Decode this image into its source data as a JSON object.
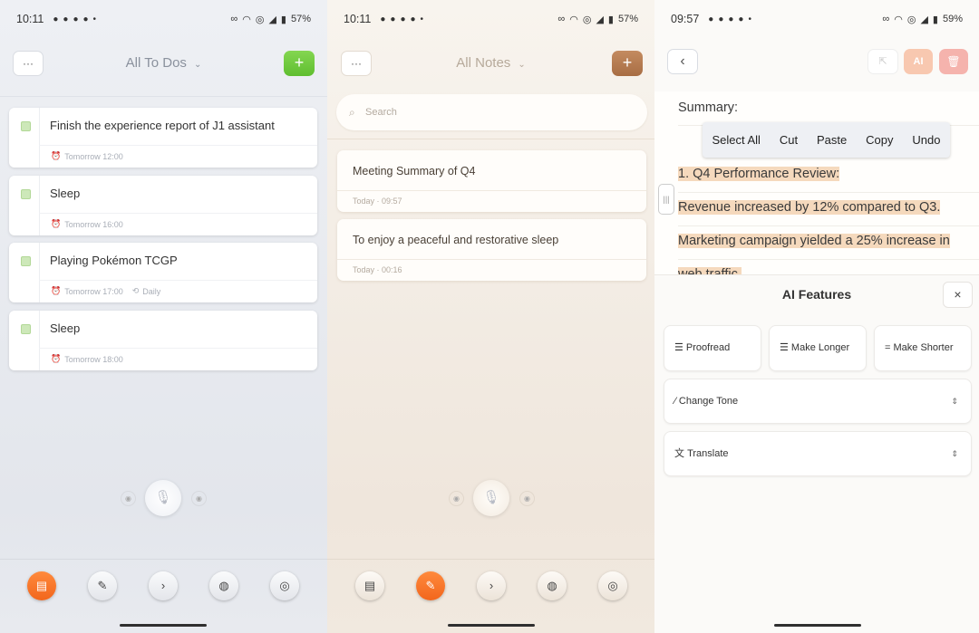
{
  "todos_screen": {
    "status": {
      "time": "10:11",
      "battery": "57%"
    },
    "title": "All To Dos",
    "menu_label": "···",
    "add_label": "+",
    "accent": "#6cc93f",
    "items": [
      {
        "title": "Finish the experience report of J1 assistant",
        "meta": "Tomorrow 12:00",
        "repeat": ""
      },
      {
        "title": "Sleep",
        "meta": "Tomorrow 16:00",
        "repeat": ""
      },
      {
        "title": "Playing Pokémon TCGP",
        "meta": "Tomorrow 17:00",
        "repeat": "Daily"
      },
      {
        "title": "Sleep",
        "meta": "Tomorrow 18:00",
        "repeat": ""
      }
    ]
  },
  "notes_screen": {
    "status": {
      "time": "10:11",
      "battery": "57%"
    },
    "title": "All Notes",
    "menu_label": "···",
    "add_label": "+",
    "accent": "#b77a4e",
    "search_placeholder": "Search",
    "notes": [
      {
        "title": "Meeting Summary of Q4",
        "meta": "Today · 09:57"
      },
      {
        "title": "To enjoy a peaceful and restorative sleep",
        "meta": "Today · 00:16"
      }
    ]
  },
  "editor_screen": {
    "status": {
      "time": "09:57",
      "battery": "59%"
    },
    "back_label": "‹",
    "ai_label": "AI",
    "lines": [
      "Summary:",
      "1. Q4 Performance Review:",
      "Revenue increased by 12% compared to Q3.",
      "Marketing campaign yielded a 25% increase in",
      "web traffic."
    ],
    "context_menu": [
      "Select All",
      "Cut",
      "Paste",
      "Copy",
      "Undo"
    ],
    "ai_panel": {
      "title": "AI Features",
      "close_label": "×",
      "buttons": [
        "Proofread",
        "Make Longer",
        "Make Shorter"
      ],
      "selects": [
        "Change Tone",
        "Translate"
      ]
    }
  },
  "nav_icons": [
    "todo-icon",
    "notes-icon",
    "flow-icon",
    "chat-icon",
    "discover-icon"
  ]
}
